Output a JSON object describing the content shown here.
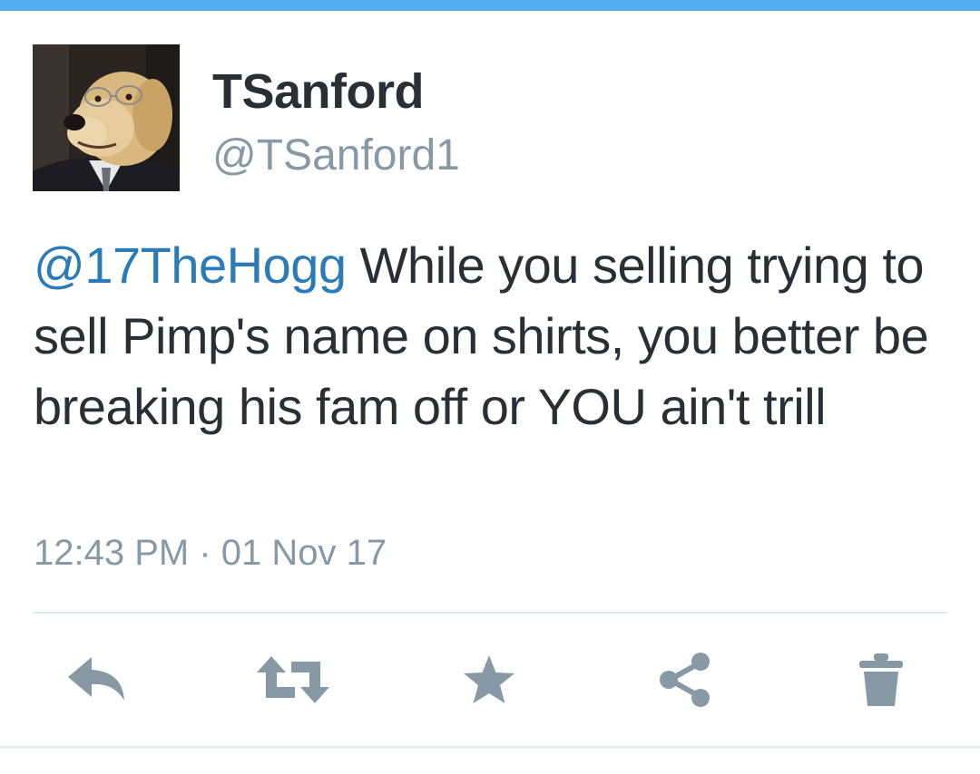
{
  "tweet": {
    "display_name": "TSanford",
    "handle": "@TSanford1",
    "mention": "@17TheHogg",
    "body": " While you selling trying to sell Pimp's name on shirts, you better be breaking his fam off or YOU ain't trill",
    "timestamp": "12:43 PM · 01 Nov 17"
  },
  "actions": [
    {
      "icon": "reply-icon"
    },
    {
      "icon": "retweet-icon"
    },
    {
      "icon": "favorite-star-icon"
    },
    {
      "icon": "share-icon"
    },
    {
      "icon": "delete-trash-icon"
    }
  ],
  "colors": {
    "accent_bar": "#55acee",
    "mention": "#2b7bb9",
    "text": "#292f33",
    "secondary": "#8899a6",
    "icon": "#8899a6"
  }
}
